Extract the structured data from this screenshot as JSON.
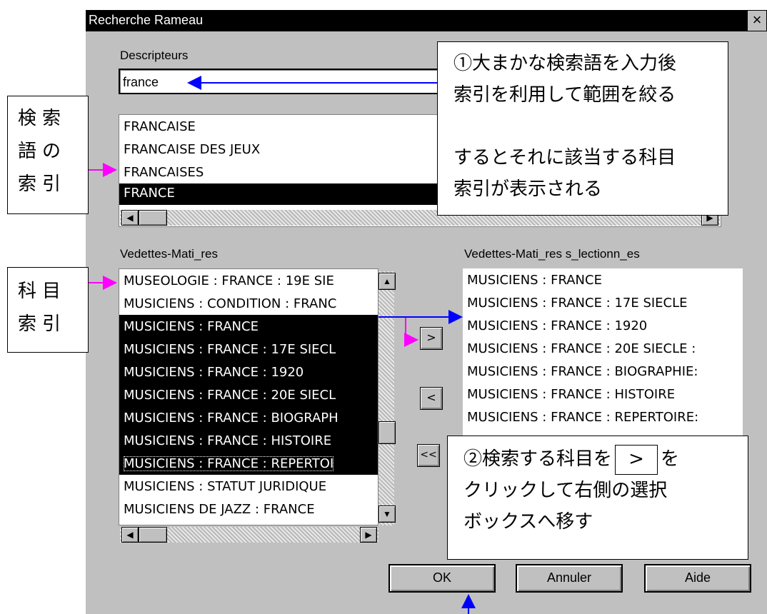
{
  "window": {
    "title": "Recherche Rameau",
    "close_label": "×"
  },
  "descripteurs": {
    "label": "Descripteurs",
    "value": "france"
  },
  "index_list": {
    "items": [
      "FRANCAISE",
      "FRANCAISE DES JEUX",
      "FRANCAISES",
      "FRANCE"
    ],
    "selected": "FRANCE"
  },
  "vedettes": {
    "label": "Vedettes-Mati_res",
    "items": [
      "MUSEOLOGIE : FRANCE : 19E SIE",
      "MUSICIENS : CONDITION : FRANC",
      "MUSICIENS : FRANCE",
      "MUSICIENS : FRANCE : 17E SIECL",
      "MUSICIENS : FRANCE : 1920",
      "MUSICIENS : FRANCE : 20E SIECL",
      "MUSICIENS : FRANCE : BIOGRAPH",
      "MUSICIENS : FRANCE : HISTOIRE",
      "MUSICIENS : FRANCE : REPERTOI",
      "MUSICIENS : STATUT JURIDIQUE",
      "MUSICIENS DE JAZZ : FRANCE"
    ]
  },
  "selected_vedettes": {
    "label": "Vedettes-Mati_res s_lectionn_es",
    "items": [
      "MUSICIENS : FRANCE",
      "MUSICIENS : FRANCE : 17E SIECLE",
      "MUSICIENS : FRANCE : 1920",
      "MUSICIENS : FRANCE : 20E SIECLE :",
      "MUSICIENS : FRANCE : BIOGRAPHIE:",
      "MUSICIENS : FRANCE : HISTOIRE",
      "MUSICIENS : FRANCE : REPERTOIRE:"
    ]
  },
  "move_buttons": {
    "add": ">",
    "remove": "<",
    "remove_all": "<<"
  },
  "dialog_buttons": {
    "ok": "OK",
    "cancel": "Annuler",
    "help": "Aide"
  },
  "annotations": {
    "index_label": [
      "検索",
      "語の",
      "索引"
    ],
    "subject_label": [
      "科目",
      "索引"
    ],
    "note1": [
      "①大まかな検索語を入力後",
      "索引を利用して範囲を絞る",
      "",
      "するとそれに該当する科目",
      "索引が表示される"
    ],
    "note2_a": "②検索する科目を",
    "note2_btn": ">",
    "note2_b": "を",
    "note2_lines": [
      "クリックして右側の選択",
      "ボックスへ移す"
    ]
  },
  "colors": {
    "blue_arrow": "#0000ff",
    "magenta_arrow": "#ff00ff",
    "dialog_gray": "#c0c0c0"
  }
}
